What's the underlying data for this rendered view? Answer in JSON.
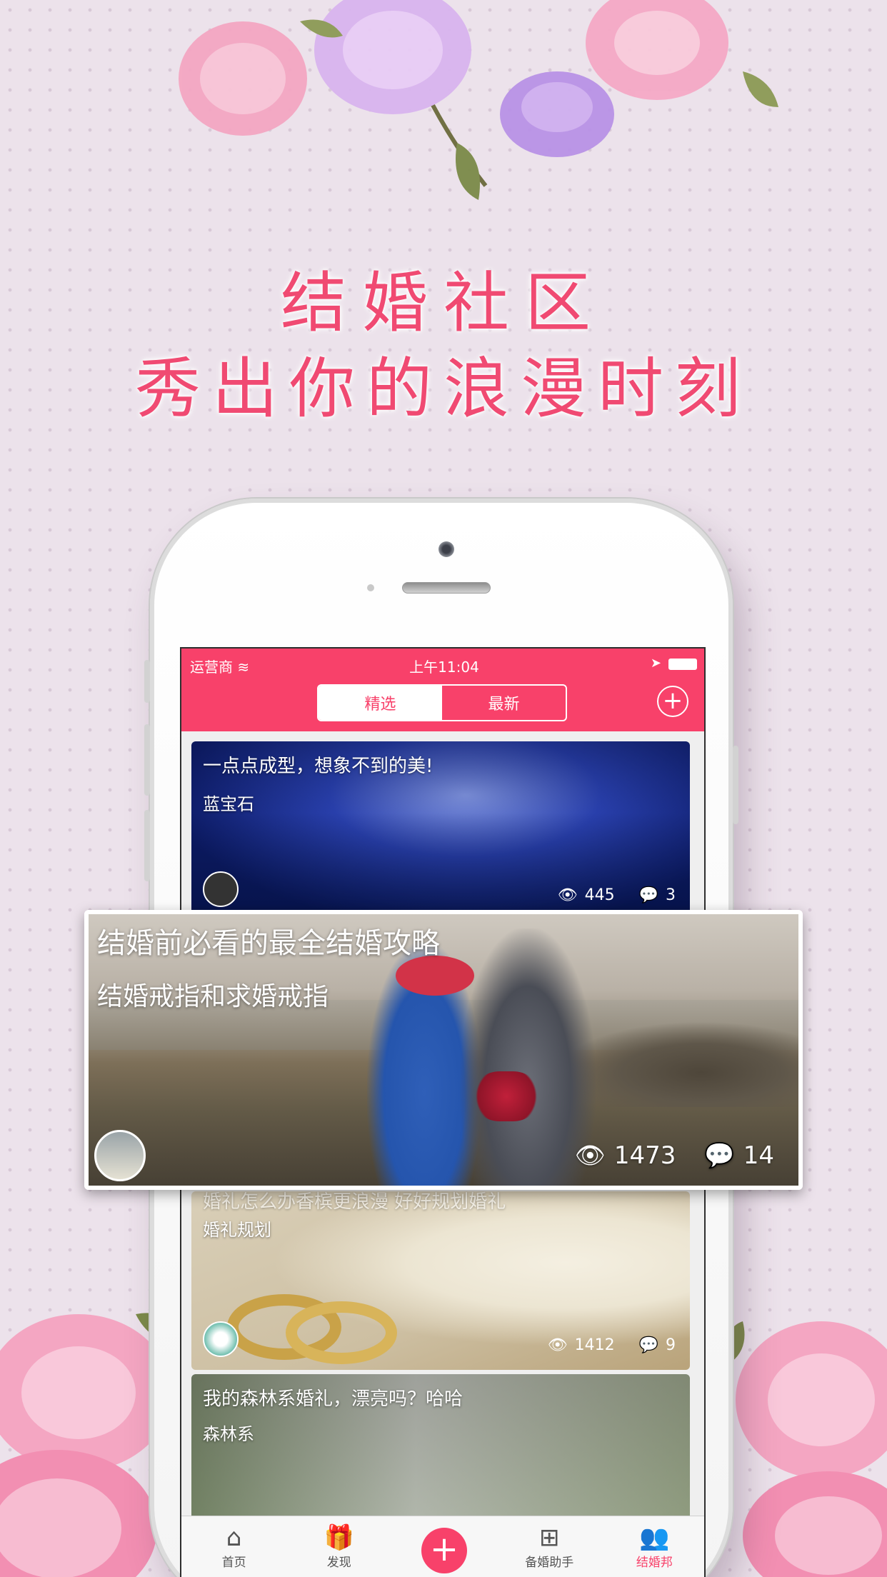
{
  "headline": {
    "line1": "结婚社区",
    "line2": "秀出你的浪漫时刻"
  },
  "status_bar": {
    "carrier": "运营商",
    "time": "上午11:04"
  },
  "nav": {
    "tabs": [
      "精选",
      "最新"
    ],
    "selected_tab": "精选"
  },
  "posts": [
    {
      "title": "一点点成型，想象不到的美!",
      "tag": "蓝宝石",
      "views": "445",
      "comments": "3"
    },
    {
      "title": "结婚前必看的最全结婚攻略",
      "tag": "结婚戒指和求婚戒指",
      "views": "1473",
      "comments": "14"
    },
    {
      "title": "婚礼怎么办香槟更浪漫 好好规划婚礼",
      "tag": "婚礼规划",
      "views": "1412",
      "comments": "9"
    },
    {
      "title": "我的森林系婚礼，漂亮吗？哈哈",
      "tag": "森林系"
    }
  ],
  "tabbar": {
    "items": [
      {
        "label": "首页",
        "icon": "home-icon"
      },
      {
        "label": "发现",
        "icon": "gift-icon"
      },
      {
        "label": "",
        "icon": "plus-icon"
      },
      {
        "label": "备婚助手",
        "icon": "grid-icon"
      },
      {
        "label": "结婚邦",
        "icon": "people-icon"
      }
    ],
    "active": "结婚邦"
  },
  "colors": {
    "accent": "#f8416a",
    "headline": "#f04a72",
    "background": "#ece2eb"
  }
}
